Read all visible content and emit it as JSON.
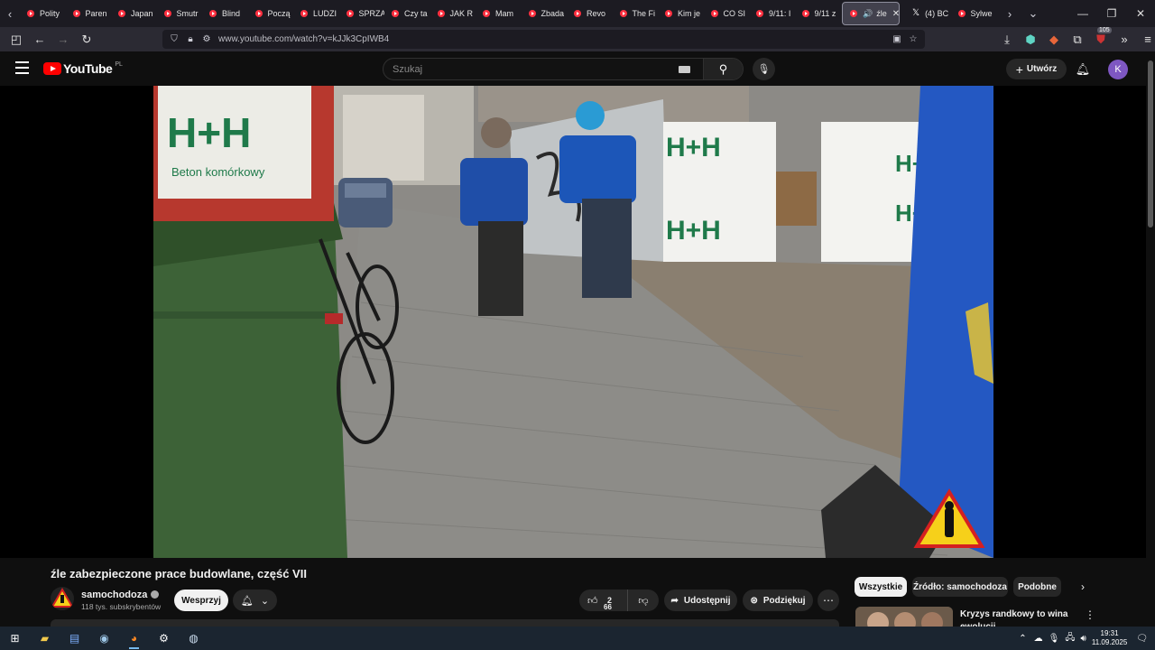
{
  "browser": {
    "tabs": [
      {
        "label": "Polity"
      },
      {
        "label": "Paren"
      },
      {
        "label": "Japan"
      },
      {
        "label": "Smutr"
      },
      {
        "label": "Blind"
      },
      {
        "label": "Począ"
      },
      {
        "label": "LUDZI"
      },
      {
        "label": "SPRZĄ"
      },
      {
        "label": "Czy ta"
      },
      {
        "label": "JAK R"
      },
      {
        "label": "Mam"
      },
      {
        "label": "Zbada"
      },
      {
        "label": "Revo"
      },
      {
        "label": "The Fi"
      },
      {
        "label": "Kim je"
      },
      {
        "label": "CO SI"
      },
      {
        "label": "9/11: I"
      },
      {
        "label": "9/11 z"
      }
    ],
    "active_tab": {
      "label": "źle"
    },
    "after_tabs": [
      {
        "label": "(4) BC",
        "icon": "x"
      },
      {
        "label": "Sylwe",
        "icon": "yt"
      }
    ],
    "url": "www.youtube.com/watch?v=kJJk3CpIWB4",
    "extension_badge": "105"
  },
  "youtube": {
    "logo_text": "YouTube",
    "region": "PL",
    "search_placeholder": "Szukaj",
    "create_label": "Utwórz",
    "avatar_letter": "K"
  },
  "video": {
    "title": "źle zabezpieczone prace budowlane, część VII",
    "sign_text_1": "H+H",
    "sign_text_2": "Beton komórkowy",
    "channel": {
      "name": "samochodoza",
      "subscribers": "118 tys. subskrybentów"
    },
    "join_label": "Wesprzyj",
    "like_count_a": "2",
    "like_count_b": "66",
    "share_label": "Udostępnij",
    "thanks_label": "Podziękuj"
  },
  "sidebar": {
    "chips": [
      {
        "label": "Wszystkie",
        "active": true
      },
      {
        "label": "Źródło: samochodoza",
        "active": false
      },
      {
        "label": "Podobne",
        "active": false
      }
    ],
    "rec_title": "Kryzys randkowy to wina ewolucji"
  },
  "taskbar": {
    "time": "19:31",
    "date": "11.09.2025"
  }
}
